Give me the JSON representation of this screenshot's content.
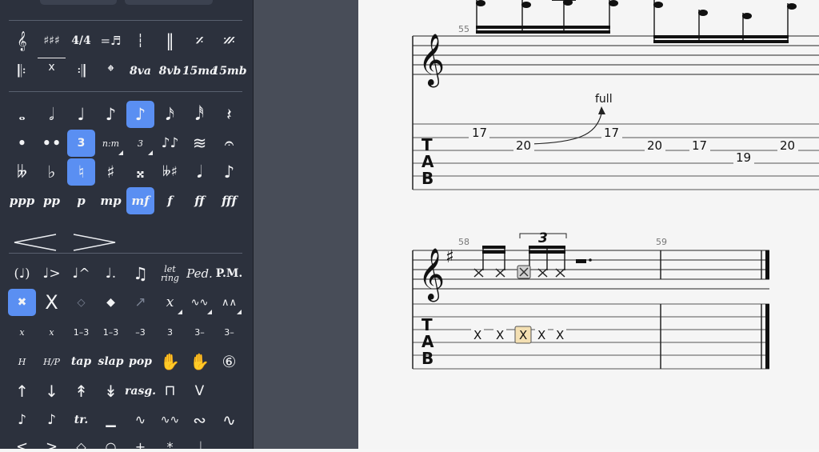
{
  "palette": {
    "notation_row1": [
      "𝄞",
      "♯♯♯",
      "4/4",
      "=♬",
      "┆",
      "‖",
      "𝄎",
      "𝄏"
    ],
    "notation_row2": [
      "𝄆",
      "x",
      "𝄇",
      "𝄌",
      "8va",
      "8vb",
      "15ma",
      "15mb"
    ],
    "durations": [
      "𝅝",
      "𝅗𝅥",
      "♩",
      "♪",
      "♪",
      "𝅘𝅥𝅯",
      "𝅘𝅥𝅰",
      "𝄽"
    ],
    "duration_mods": [
      "•",
      "••",
      "3",
      "n:m",
      "3",
      "♪♪",
      "≋",
      "𝄐"
    ],
    "accidentals": [
      "𝄫",
      "♭",
      "♮",
      "♯",
      "𝄪",
      "𝄫♯",
      "𝅘𝅥",
      "♪"
    ],
    "dynamics": [
      "ppp",
      "pp",
      "p",
      "mp",
      "mf",
      "f",
      "ff",
      "fff"
    ],
    "hairpins": [
      "crescendo",
      "decrescendo"
    ],
    "articulation_row1": [
      "(♩)",
      "♩>",
      "♩^",
      "♩.",
      "♫",
      "let ring",
      "Ped.",
      "P.M."
    ],
    "notehead_row": [
      "✖",
      "X",
      "◇",
      "◆",
      "↗",
      "x",
      "∿∿",
      "∧∧"
    ],
    "slide_row": [
      "x",
      "x",
      "1–3",
      "1–3",
      "–3",
      "3",
      "3–",
      "3–"
    ],
    "technique_row": [
      "H",
      "H/P",
      "tap",
      "slap",
      "pop",
      "✋",
      "✋",
      "⑥"
    ],
    "stroke_row": [
      "↑",
      "↓",
      "↟",
      "↡",
      "rasg.",
      "⊓",
      "V"
    ],
    "ornament_row": [
      "♪",
      "♪",
      "tr.",
      "▁",
      "∿",
      "∿∿",
      "∾",
      "∿"
    ],
    "bottom_row": [
      "<",
      ">",
      "◇",
      "○",
      "+",
      "*",
      "♩"
    ]
  },
  "score": {
    "measure_numbers": [
      "55",
      "58",
      "59"
    ],
    "bend_label": "full",
    "tab_clef": [
      "T",
      "A",
      "B"
    ],
    "tab_numbers_m55": [
      "17",
      "20",
      "17",
      "20",
      "17",
      "19",
      "20"
    ],
    "tab_numbers_m58": [
      "X",
      "X",
      "X",
      "X",
      "X"
    ],
    "tuplet_number": "3",
    "key_signature": "♯",
    "treble_clef": "𝄞"
  },
  "colors": {
    "palette_bg": "#2c313d",
    "selected": "#5a8ff2",
    "gutter": "#484d58",
    "score_bg": "#f5f5f5",
    "selected_note": "#f3dfb2"
  }
}
